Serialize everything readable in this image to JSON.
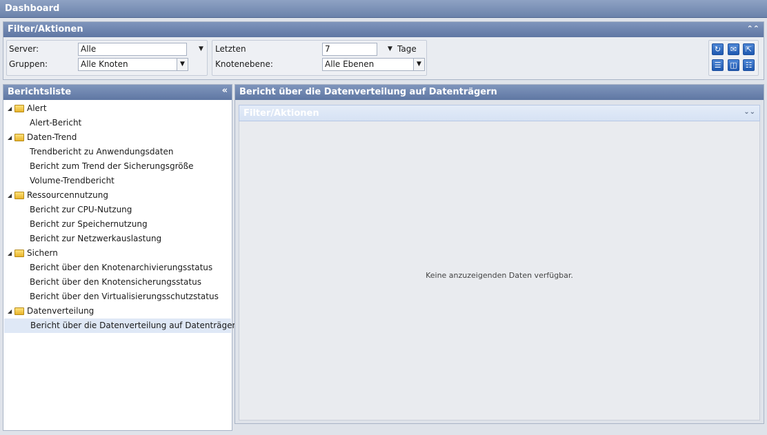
{
  "window": {
    "title": "Dashboard"
  },
  "filter_panel": {
    "title": "Filter/Aktionen",
    "collapse_icon": "double-chevron-up-icon",
    "server_label": "Server:",
    "server_value": "Alle",
    "groups_label": "Gruppen:",
    "groups_value": "Alle Knoten",
    "last_label": "Letzten",
    "last_value": "7",
    "days_unit": "Tage",
    "node_level_label": "Knotenebene:",
    "node_level_value": "Alle Ebenen",
    "tools": [
      "refresh-icon",
      "email-icon",
      "export-icon",
      "list-view-icon",
      "two-column-view-icon",
      "three-column-view-icon"
    ]
  },
  "report_list": {
    "title": "Berichtsliste",
    "collapse_icon": "double-chevron-left-icon",
    "categories": [
      {
        "label": "Alert",
        "items": [
          "Alert-Bericht"
        ]
      },
      {
        "label": "Daten-Trend",
        "items": [
          "Trendbericht zu Anwendungsdaten",
          "Bericht zum Trend der Sicherungsgröße",
          "Volume-Trendbericht"
        ]
      },
      {
        "label": "Ressourcennutzung",
        "items": [
          "Bericht zur CPU-Nutzung",
          "Bericht zur Speichernutzung",
          "Bericht zur Netzwerkauslastung"
        ]
      },
      {
        "label": "Sichern",
        "items": [
          "Bericht über den Knotenarchivierungsstatus",
          "Bericht über den Knotensicherungsstatus",
          "Bericht über den Virtualisierungsschutzstatus"
        ]
      },
      {
        "label": "Datenverteilung",
        "items": [
          "Bericht über die Datenverteilung auf Datenträgern"
        ]
      }
    ],
    "selected": "Bericht über die Datenverteilung auf Datenträgern"
  },
  "report_view": {
    "title": "Bericht über die Datenverteilung auf Datenträgern",
    "filter_title": "Filter/Aktionen",
    "expand_icon": "double-chevron-down-icon",
    "empty_message": "Keine anzuzeigenden Daten verfügbar."
  }
}
